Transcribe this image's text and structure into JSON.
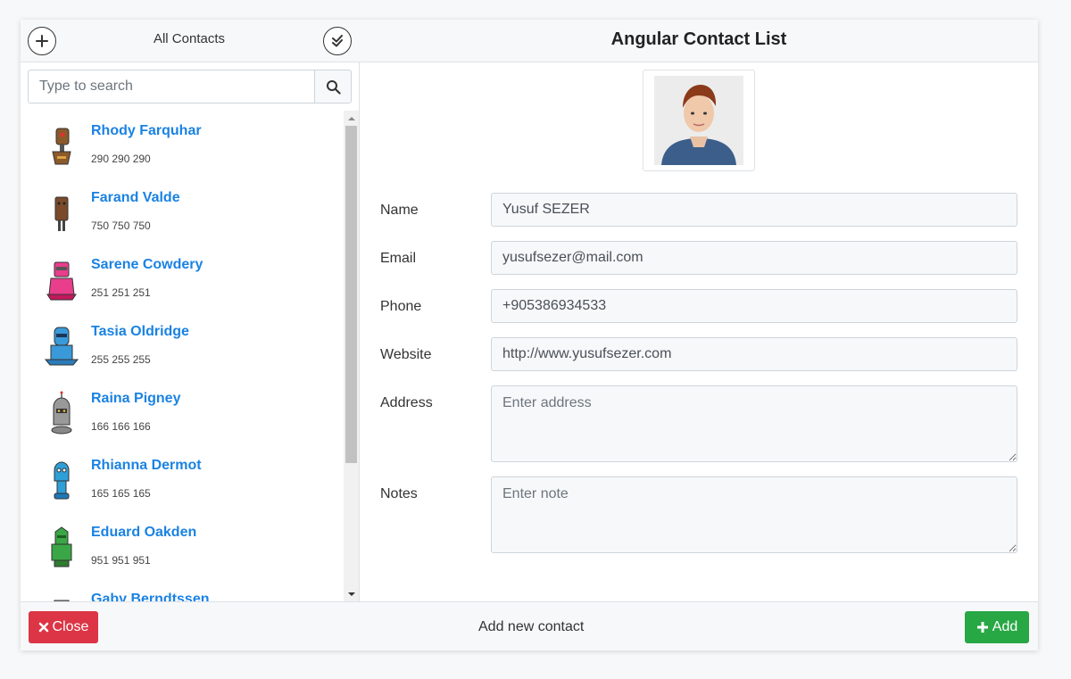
{
  "sidebar": {
    "title": "All Contacts",
    "search_placeholder": "Type to search",
    "contacts": [
      {
        "name": "Rhody Farquhar",
        "phone": "290 290 290",
        "avatar_color": "#8b5a2b"
      },
      {
        "name": "Farand Valde",
        "phone": "750 750 750",
        "avatar_color": "#7a4a2a"
      },
      {
        "name": "Sarene Cowdery",
        "phone": "251 251 251",
        "avatar_color": "#e83e8c"
      },
      {
        "name": "Tasia Oldridge",
        "phone": "255 255 255",
        "avatar_color": "#3a9ad9"
      },
      {
        "name": "Raina Pigney",
        "phone": "166 166 166",
        "avatar_color": "#888888"
      },
      {
        "name": "Rhianna Dermot",
        "phone": "165 165 165",
        "avatar_color": "#2f9fd8"
      },
      {
        "name": "Eduard Oakden",
        "phone": "951 951 951",
        "avatar_color": "#3aa645"
      },
      {
        "name": "Gaby Berndtssen",
        "phone": "",
        "avatar_color": "#999999"
      }
    ]
  },
  "main": {
    "title": "Angular Contact List",
    "form": {
      "name_label": "Name",
      "name_value": "Yusuf SEZER",
      "email_label": "Email",
      "email_value": "yusufsezer@mail.com",
      "phone_label": "Phone",
      "phone_value": "+905386934533",
      "website_label": "Website",
      "website_value": "http://www.yusufsezer.com",
      "address_label": "Address",
      "address_placeholder": "Enter address",
      "notes_label": "Notes",
      "notes_placeholder": "Enter note"
    }
  },
  "footer": {
    "close_label": "Close",
    "status_text": "Add new contact",
    "add_label": "Add"
  },
  "colors": {
    "link": "#1a82e2",
    "danger": "#dc3545",
    "success": "#28a745"
  }
}
